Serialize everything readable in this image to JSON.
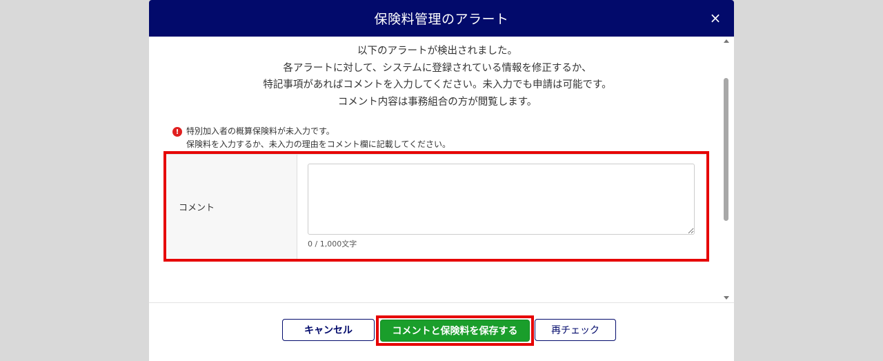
{
  "modal": {
    "title": "保険料管理のアラート",
    "close_label": "×"
  },
  "intro": {
    "lines": [
      "以下のアラートが検出されました。",
      "各アラートに対して、システムに登録されている情報を修正するか、",
      "特記事項があればコメントを入力してください。未入力でも申請は可能です。",
      "コメント内容は事務組合の方が閲覧します。"
    ]
  },
  "alert": {
    "icon": "exclamation-icon",
    "line1": "特別加入者の概算保険料が未入力です。",
    "line2": "保険料を入力するか、未入力の理由をコメント欄に記載してください。"
  },
  "form": {
    "comment_label": "コメント",
    "comment_value": "",
    "char_count": "0 / 1,000文字"
  },
  "footer": {
    "cancel_label": "キャンセル",
    "save_label": "コメントと保険料を保存する",
    "recheck_label": "再チェック"
  },
  "colors": {
    "header_bg": "#020a6b",
    "highlight": "#e60000",
    "save_bg": "#1a9e2b",
    "alert_icon": "#e02020"
  }
}
